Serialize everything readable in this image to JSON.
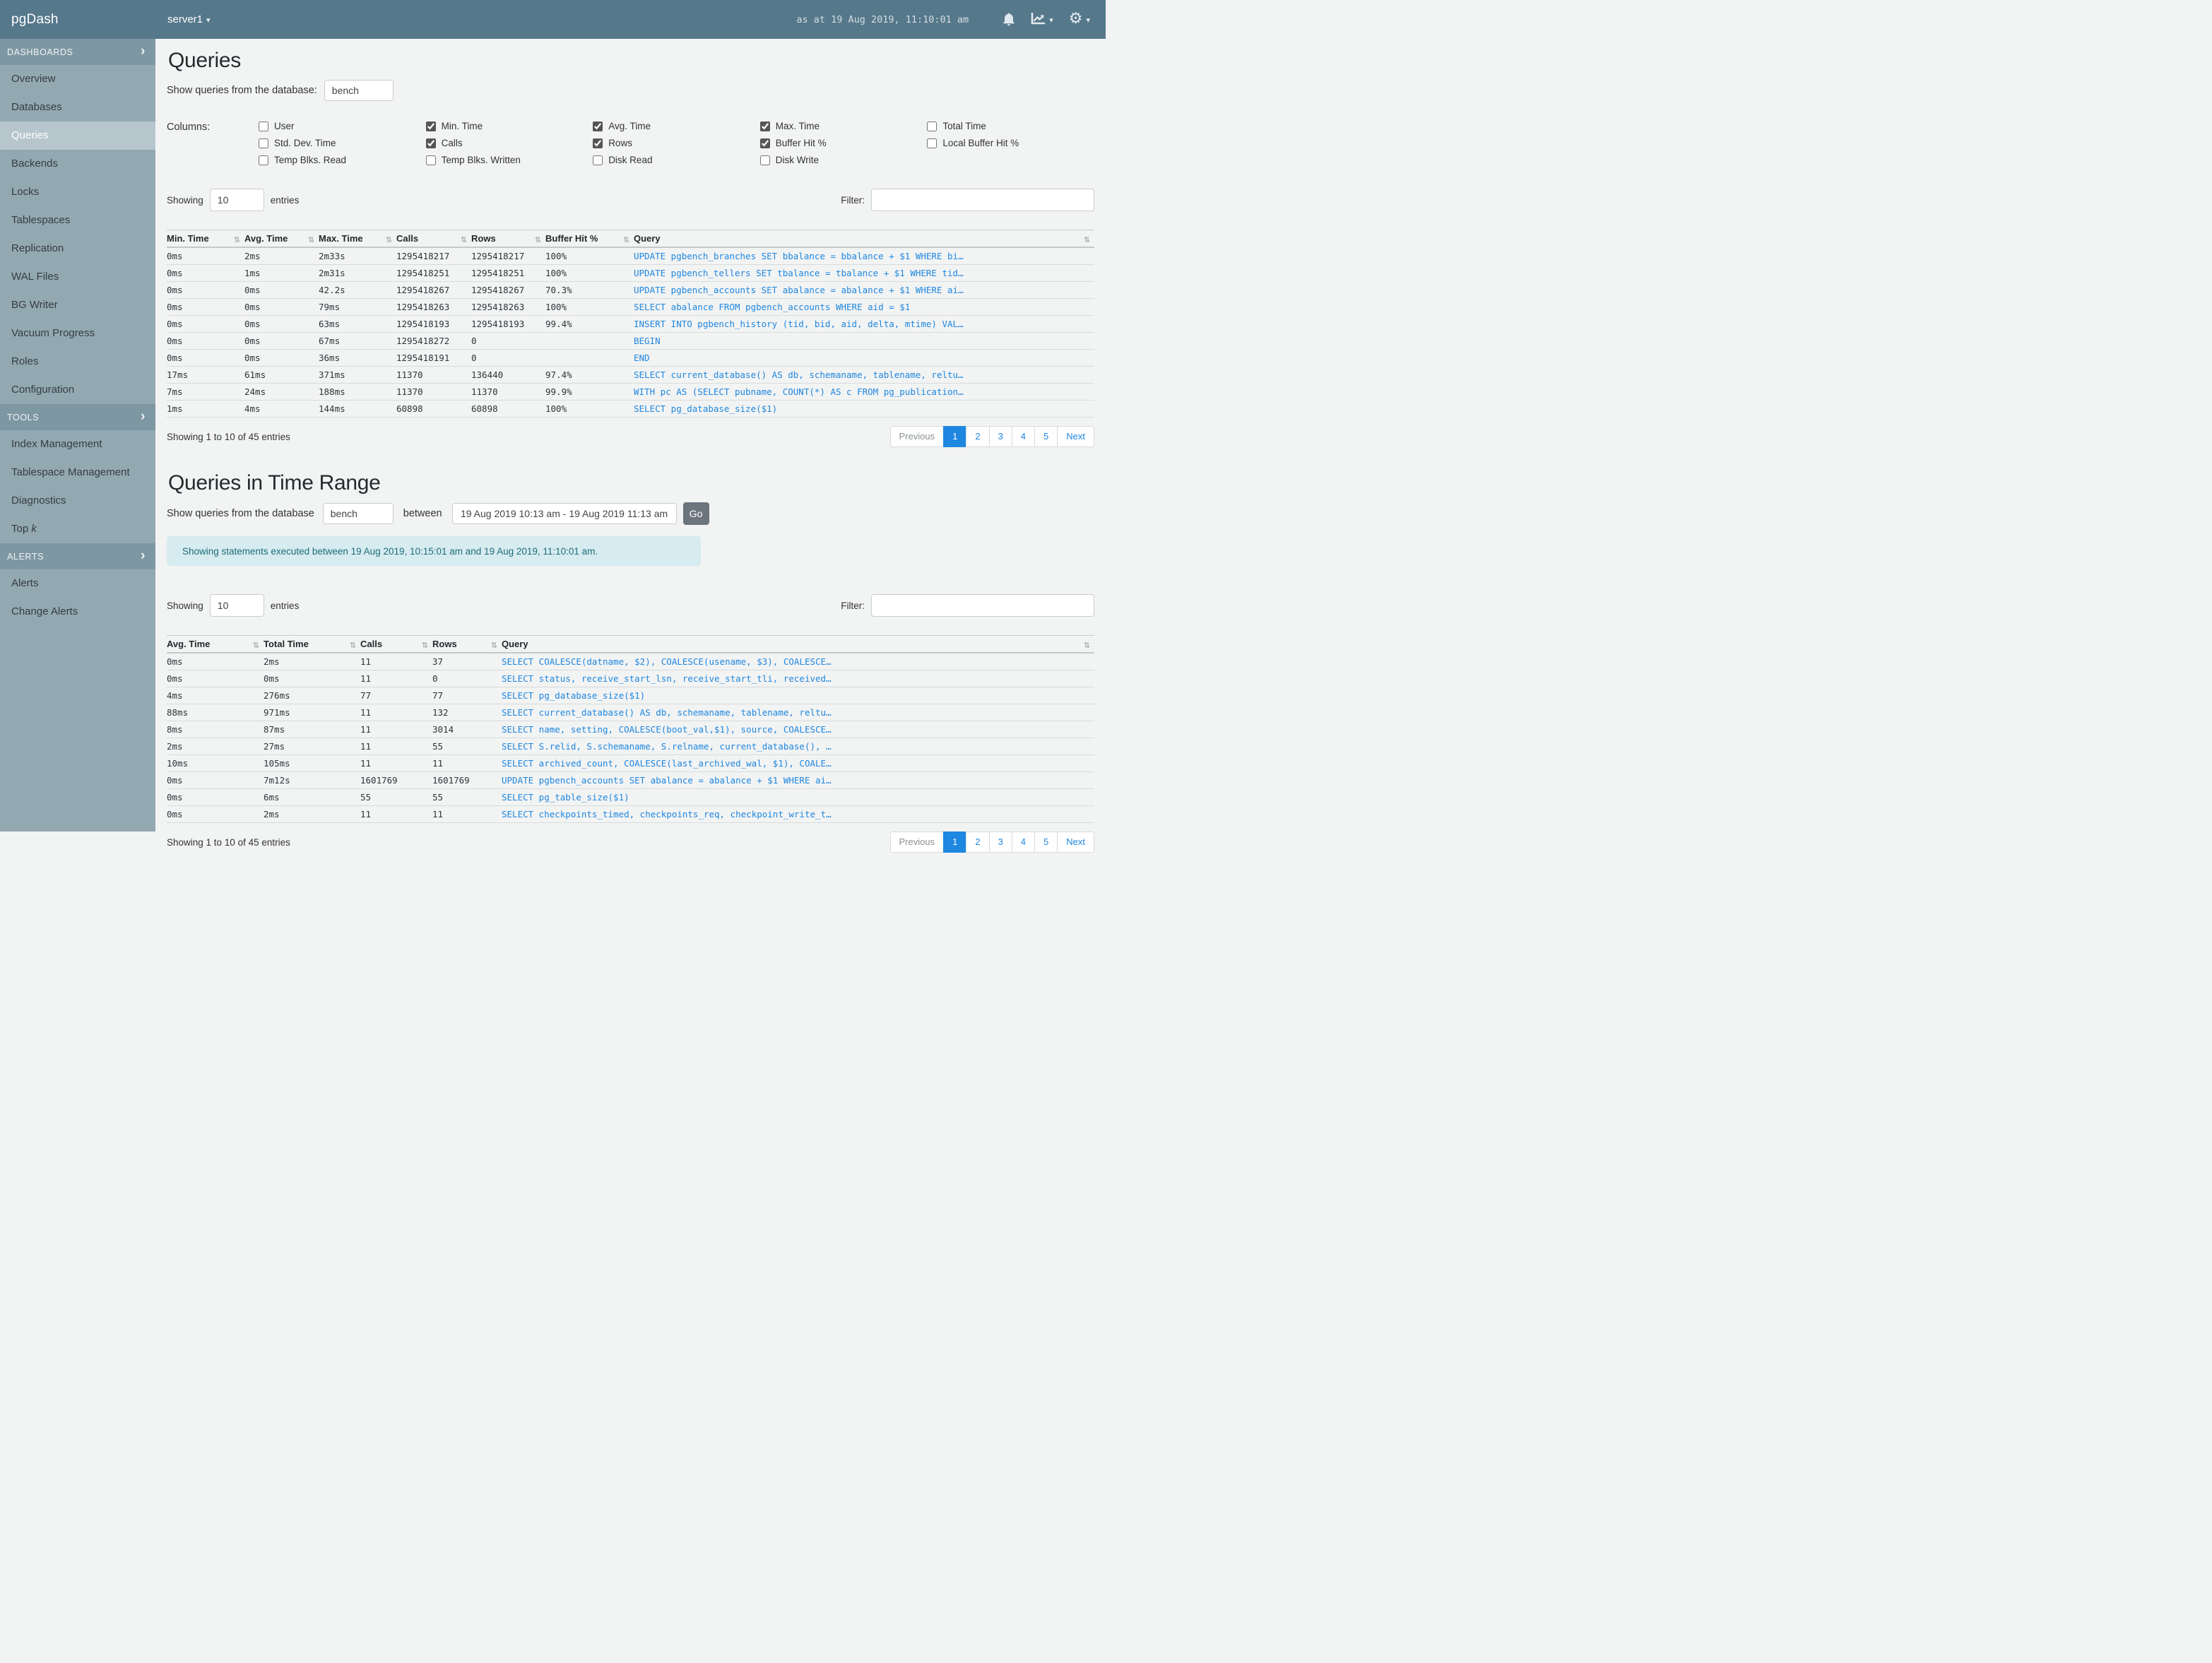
{
  "topbar": {
    "brand": "pgDash",
    "server": "server1",
    "timestamp": "as at 19 Aug 2019, 11:10:01 am",
    "icons": [
      "bell",
      "chart-line",
      "gear"
    ]
  },
  "sidebar": {
    "sections": [
      {
        "label": "DASHBOARDS",
        "active_index": 2,
        "items": [
          {
            "label": "Overview"
          },
          {
            "label": "Databases"
          },
          {
            "label": "Queries"
          },
          {
            "label": "Backends"
          },
          {
            "label": "Locks"
          },
          {
            "label": "Tablespaces"
          },
          {
            "label": "Replication"
          },
          {
            "label": "WAL Files"
          },
          {
            "label": "BG Writer"
          },
          {
            "label": "Vacuum Progress"
          },
          {
            "label": "Roles"
          },
          {
            "label": "Configuration"
          }
        ]
      },
      {
        "label": "TOOLS",
        "items": [
          {
            "label": "Index Management"
          },
          {
            "label": "Tablespace Management"
          },
          {
            "label": "Diagnostics"
          },
          {
            "label": "Top ",
            "italic": "k"
          }
        ]
      },
      {
        "label": "ALERTS",
        "items": [
          {
            "label": "Alerts"
          },
          {
            "label": "Change Alerts"
          }
        ]
      }
    ]
  },
  "page1": {
    "title": "Queries",
    "db_label": "Show queries from the database:",
    "db_value": "bench",
    "columns_picker": {
      "label": "Columns:",
      "groups": [
        [
          {
            "label": "User",
            "checked": false
          },
          {
            "label": "Std. Dev. Time",
            "checked": false
          },
          {
            "label": "Temp Blks. Read",
            "checked": false
          }
        ],
        [
          {
            "label": "Min. Time",
            "checked": true
          },
          {
            "label": "Calls",
            "checked": true
          },
          {
            "label": "Temp Blks. Written",
            "checked": false
          }
        ],
        [
          {
            "label": "Avg. Time",
            "checked": true
          },
          {
            "label": "Rows",
            "checked": true
          },
          {
            "label": "Disk Read",
            "checked": false
          }
        ],
        [
          {
            "label": "Max. Time",
            "checked": true
          },
          {
            "label": "Buffer Hit %",
            "checked": true
          },
          {
            "label": "Disk Write",
            "checked": false
          }
        ],
        [
          {
            "label": "Total Time",
            "checked": false
          },
          {
            "label": "Local Buffer Hit %",
            "checked": false
          }
        ]
      ]
    },
    "showing_prefix": "Showing",
    "showing_value": "10",
    "showing_suffix": "entries",
    "filter_label": "Filter:",
    "table": {
      "headers": [
        "Min. Time",
        "Avg. Time",
        "Max. Time",
        "Calls",
        "Rows",
        "Buffer Hit %",
        "Query"
      ],
      "rows": [
        {
          "min": "0ms",
          "avg": "2ms",
          "max": "2m33s",
          "calls": "1295418217",
          "rows": "1295418217",
          "buffer": "100%",
          "query": "UPDATE pgbench_branches SET bbalance = bbalance + $1 WHERE bi…"
        },
        {
          "min": "0ms",
          "avg": "1ms",
          "max": "2m31s",
          "calls": "1295418251",
          "rows": "1295418251",
          "buffer": "100%",
          "query": "UPDATE pgbench_tellers SET tbalance = tbalance + $1 WHERE tid…"
        },
        {
          "min": "0ms",
          "avg": "0ms",
          "max": "42.2s",
          "calls": "1295418267",
          "rows": "1295418267",
          "buffer": "70.3%",
          "query": "UPDATE pgbench_accounts SET abalance = abalance + $1 WHERE ai…"
        },
        {
          "min": "0ms",
          "avg": "0ms",
          "max": "79ms",
          "calls": "1295418263",
          "rows": "1295418263",
          "buffer": "100%",
          "query": "SELECT abalance FROM pgbench_accounts WHERE aid = $1"
        },
        {
          "min": "0ms",
          "avg": "0ms",
          "max": "63ms",
          "calls": "1295418193",
          "rows": "1295418193",
          "buffer": "99.4%",
          "query": "INSERT INTO pgbench_history (tid, bid, aid, delta, mtime) VAL…"
        },
        {
          "min": "0ms",
          "avg": "0ms",
          "max": "67ms",
          "calls": "1295418272",
          "rows": "0",
          "buffer": "",
          "query": "BEGIN"
        },
        {
          "min": "0ms",
          "avg": "0ms",
          "max": "36ms",
          "calls": "1295418191",
          "rows": "0",
          "buffer": "",
          "query": "END"
        },
        {
          "min": "17ms",
          "avg": "61ms",
          "max": "371ms",
          "calls": "11370",
          "rows": "136440",
          "buffer": "97.4%",
          "query": "SELECT current_database() AS db, schemaname, tablename, reltu…"
        },
        {
          "min": "7ms",
          "avg": "24ms",
          "max": "188ms",
          "calls": "11370",
          "rows": "11370",
          "buffer": "99.9%",
          "query": "WITH pc AS (SELECT pubname, COUNT(*) AS c FROM pg_publication…"
        },
        {
          "min": "1ms",
          "avg": "4ms",
          "max": "144ms",
          "calls": "60898",
          "rows": "60898",
          "buffer": "100%",
          "query": "SELECT pg_database_size($1)"
        }
      ]
    },
    "footer_text": "Showing 1 to 10 of 45 entries",
    "pagination": {
      "previous": "Previous",
      "pages": [
        "1",
        "2",
        "3",
        "4",
        "5"
      ],
      "next": "Next",
      "active_index": 0
    }
  },
  "section2": {
    "title": "Queries in Time Range",
    "db_label": "Show queries from the database",
    "db_value": "bench",
    "between_label": "between",
    "range_value": "19 Aug 2019 10:13 am - 19 Aug 2019 11:13 am",
    "go_label": "Go",
    "notice": "Showing statements executed between 19 Aug 2019, 10:15:01 am and 19 Aug 2019, 11:10:01 am.",
    "showing_prefix": "Showing",
    "showing_value": "10",
    "showing_suffix": "entries",
    "filter_label": "Filter:",
    "table": {
      "headers": [
        "Avg. Time",
        "Total Time",
        "Calls",
        "Rows",
        "Query"
      ],
      "rows": [
        {
          "avg": "0ms",
          "total": "2ms",
          "calls": "11",
          "rows": "37",
          "query": "SELECT COALESCE(datname, $2), COALESCE(usename, $3), COALESCE…"
        },
        {
          "avg": "0ms",
          "total": "0ms",
          "calls": "11",
          "rows": "0",
          "query": "SELECT status, receive_start_lsn, receive_start_tli, received…"
        },
        {
          "avg": "4ms",
          "total": "276ms",
          "calls": "77",
          "rows": "77",
          "query": "SELECT pg_database_size($1)"
        },
        {
          "avg": "88ms",
          "total": "971ms",
          "calls": "11",
          "rows": "132",
          "query": "SELECT current_database() AS db, schemaname, tablename, reltu…"
        },
        {
          "avg": "8ms",
          "total": "87ms",
          "calls": "11",
          "rows": "3014",
          "query": "SELECT name, setting, COALESCE(boot_val,$1), source, COALESCE…"
        },
        {
          "avg": "2ms",
          "total": "27ms",
          "calls": "11",
          "rows": "55",
          "query": "SELECT S.relid, S.schemaname, S.relname, current_database(), …"
        },
        {
          "avg": "10ms",
          "total": "105ms",
          "calls": "11",
          "rows": "11",
          "query": "SELECT archived_count, COALESCE(last_archived_wal, $1), COALE…"
        },
        {
          "avg": "0ms",
          "total": "7m12s",
          "calls": "1601769",
          "rows": "1601769",
          "query": "UPDATE pgbench_accounts SET abalance = abalance + $1 WHERE ai…"
        },
        {
          "avg": "0ms",
          "total": "6ms",
          "calls": "55",
          "rows": "55",
          "query": "SELECT pg_table_size($1)"
        },
        {
          "avg": "0ms",
          "total": "2ms",
          "calls": "11",
          "rows": "11",
          "query": "SELECT checkpoints_timed, checkpoints_req, checkpoint_write_t…"
        }
      ]
    },
    "footer_text": "Showing 1 to 10 of 45 entries",
    "pagination": {
      "previous": "Previous",
      "pages": [
        "1",
        "2",
        "3",
        "4",
        "5"
      ],
      "next": "Next",
      "active_index": 0
    }
  }
}
